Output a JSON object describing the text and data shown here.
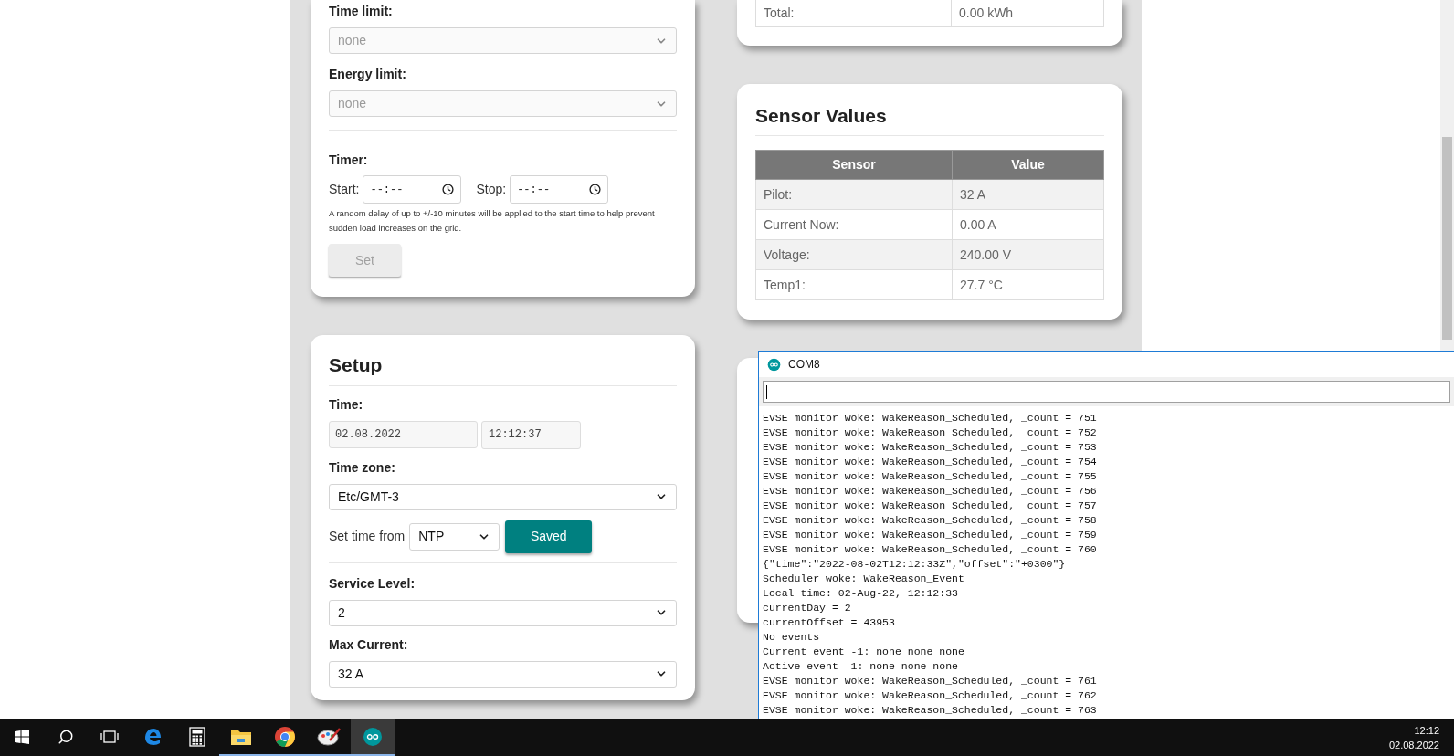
{
  "charging_card": {
    "fields": [
      {
        "label": "Time limit:",
        "value": "none",
        "disabled": true
      },
      {
        "label": "Energy limit:",
        "value": "none",
        "disabled": true
      }
    ],
    "timer": {
      "label": "Timer:",
      "start_label": "Start:",
      "start_value": "--:--",
      "stop_label": "Stop:",
      "stop_value": "--:--",
      "note": "A random delay of up to +/-10 minutes will be applied to the start time to help prevent sudden load increases on the grid.",
      "button": {
        "label": "Set",
        "disabled": true
      }
    }
  },
  "energy_card": {
    "rows": [
      {
        "label": "Total:",
        "value": "0.00 kWh"
      }
    ]
  },
  "sensor_card": {
    "title": "Sensor Values",
    "columns": [
      "Sensor",
      "Value"
    ],
    "rows": [
      {
        "label": "Pilot:",
        "value": "32 A"
      },
      {
        "label": "Current Now:",
        "value": "0.00 A"
      },
      {
        "label": "Voltage:",
        "value": "240.00 V"
      },
      {
        "label": "Temp1:",
        "value": "27.7 °C"
      }
    ]
  },
  "setup_card": {
    "title": "Setup",
    "time_label": "Time:",
    "date_value": "02.08.2022",
    "time_value": "12:12:37",
    "timezone_label": "Time zone:",
    "timezone": "Etc/GMT-3",
    "set_time_label": "Set time from",
    "set_time_source": "NTP",
    "save_button": "Saved",
    "service_level_label": "Service Level:",
    "service_level": "2",
    "max_current_label": "Max Current:",
    "max_current": "32 A"
  },
  "serial_monitor": {
    "title": "COM8",
    "lines": [
      "EVSE monitor woke: WakeReason_Scheduled, _count = 751",
      "EVSE monitor woke: WakeReason_Scheduled, _count = 752",
      "EVSE monitor woke: WakeReason_Scheduled, _count = 753",
      "EVSE monitor woke: WakeReason_Scheduled, _count = 754",
      "EVSE monitor woke: WakeReason_Scheduled, _count = 755",
      "EVSE monitor woke: WakeReason_Scheduled, _count = 756",
      "EVSE monitor woke: WakeReason_Scheduled, _count = 757",
      "EVSE monitor woke: WakeReason_Scheduled, _count = 758",
      "EVSE monitor woke: WakeReason_Scheduled, _count = 759",
      "EVSE monitor woke: WakeReason_Scheduled, _count = 760",
      "{\"time\":\"2022-08-02T12:12:33Z\",\"offset\":\"+0300\"}",
      "Scheduler woke: WakeReason_Event",
      "Local time: 02-Aug-22, 12:12:33",
      "currentDay = 2",
      "currentOffset = 43953",
      "No events",
      "Current event -1: none none none",
      "Active event -1: none none none",
      "EVSE monitor woke: WakeReason_Scheduled, _count = 761",
      "EVSE monitor woke: WakeReason_Scheduled, _count = 762",
      "EVSE monitor woke: WakeReason_Scheduled, _count = 763"
    ]
  },
  "taskbar": {
    "items": [
      {
        "kind": "start",
        "running": false,
        "selected": false
      },
      {
        "kind": "search",
        "running": false,
        "selected": false
      },
      {
        "kind": "task_view",
        "running": false,
        "selected": false
      },
      {
        "kind": "browser_e",
        "running": false,
        "selected": false
      },
      {
        "kind": "calculator",
        "running": false,
        "selected": false
      },
      {
        "kind": "folder",
        "running": true,
        "selected": false
      },
      {
        "kind": "browser_round",
        "running": true,
        "selected": false
      },
      {
        "kind": "paint",
        "running": true,
        "selected": false
      },
      {
        "kind": "infinity",
        "running": true,
        "selected": true
      }
    ],
    "clock_time": "12:12",
    "clock_date": "02.08.2022"
  }
}
